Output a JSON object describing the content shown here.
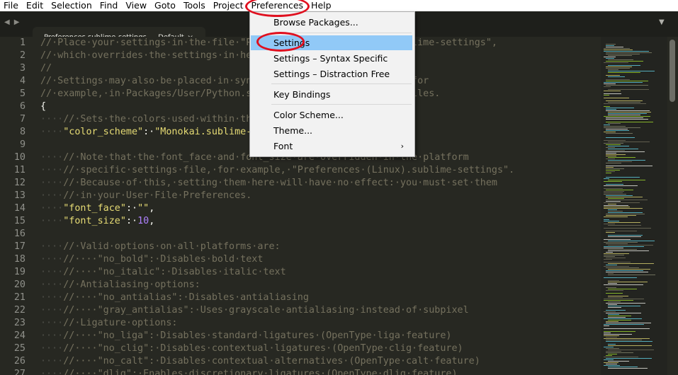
{
  "menubar": {
    "items": [
      "File",
      "Edit",
      "Selection",
      "Find",
      "View",
      "Goto",
      "Tools",
      "Project",
      "Preferences",
      "Help"
    ]
  },
  "tabbar": {
    "nav_arrows": "◀▶",
    "tab_title": "Preferences.sublime-settings — Default",
    "close_glyph": "×",
    "dropdown_glyph": "▼"
  },
  "dropdown": {
    "items": [
      "Browse Packages...",
      "Settings",
      "Settings – Syntax Specific",
      "Settings – Distraction Free",
      "Key Bindings",
      "Color Scheme...",
      "Theme...",
      "Font"
    ],
    "font_arrow": "›",
    "highlighted": "Settings"
  },
  "editor": {
    "lines": [
      {
        "n": "1",
        "segs": [
          [
            "cm",
            "//·Place·your·settings·in·the·file·\"Packages/User/Preferences.sublime-settings\","
          ]
        ]
      },
      {
        "n": "2",
        "segs": [
          [
            "cm",
            "//·which·overrides·the·settings·in·here."
          ]
        ]
      },
      {
        "n": "3",
        "segs": [
          [
            "cm",
            "//"
          ]
        ]
      },
      {
        "n": "4",
        "segs": [
          [
            "cm",
            "//·Settings·may·also·be·placed·in·syntax·specific·setting·files,·for"
          ]
        ]
      },
      {
        "n": "5",
        "segs": [
          [
            "cm",
            "//·example,·in·Packages/User/Python.sublime-settings·for·python·files."
          ]
        ]
      },
      {
        "n": "6",
        "segs": [
          [
            "punc",
            "{"
          ]
        ]
      },
      {
        "n": "7",
        "segs": [
          [
            "ws",
            "····"
          ],
          [
            "cm",
            "//·Sets·the·colors·used·within·the·text·area"
          ]
        ]
      },
      {
        "n": "8",
        "segs": [
          [
            "ws",
            "····"
          ],
          [
            "str",
            "\"color_scheme\""
          ],
          [
            "punc",
            ":·"
          ],
          [
            "str",
            "\"Monokai.sublime-color-scheme\""
          ],
          [
            "punc",
            ","
          ]
        ]
      },
      {
        "n": "9",
        "segs": []
      },
      {
        "n": "10",
        "segs": [
          [
            "ws",
            "····"
          ],
          [
            "cm",
            "//·Note·that·the·font_face·and·font_size·are·overridden·in·the·platform"
          ]
        ]
      },
      {
        "n": "11",
        "segs": [
          [
            "ws",
            "····"
          ],
          [
            "cm",
            "//·specific·settings·file,·for·example,·\"Preferences·(Linux).sublime-settings\"."
          ]
        ]
      },
      {
        "n": "12",
        "segs": [
          [
            "ws",
            "····"
          ],
          [
            "cm",
            "//·Because·of·this,·setting·them·here·will·have·no·effect:·you·must·set·them"
          ]
        ]
      },
      {
        "n": "13",
        "segs": [
          [
            "ws",
            "····"
          ],
          [
            "cm",
            "//·in·your·User·File·Preferences."
          ]
        ]
      },
      {
        "n": "14",
        "segs": [
          [
            "ws",
            "····"
          ],
          [
            "str",
            "\"font_face\""
          ],
          [
            "punc",
            ":·"
          ],
          [
            "str",
            "\"\""
          ],
          [
            "punc",
            ","
          ]
        ]
      },
      {
        "n": "15",
        "segs": [
          [
            "ws",
            "····"
          ],
          [
            "str",
            "\"font_size\""
          ],
          [
            "punc",
            ":·"
          ],
          [
            "num",
            "10"
          ],
          [
            "punc",
            ","
          ]
        ]
      },
      {
        "n": "16",
        "segs": []
      },
      {
        "n": "17",
        "segs": [
          [
            "ws",
            "····"
          ],
          [
            "cm",
            "//·Valid·options·on·all·platforms·are:"
          ]
        ]
      },
      {
        "n": "18",
        "segs": [
          [
            "ws",
            "····"
          ],
          [
            "cm",
            "//····\"no_bold\":·Disables·bold·text"
          ]
        ]
      },
      {
        "n": "19",
        "segs": [
          [
            "ws",
            "····"
          ],
          [
            "cm",
            "//····\"no_italic\":·Disables·italic·text"
          ]
        ]
      },
      {
        "n": "20",
        "segs": [
          [
            "ws",
            "····"
          ],
          [
            "cm",
            "//·Antialiasing·options:"
          ]
        ]
      },
      {
        "n": "21",
        "segs": [
          [
            "ws",
            "····"
          ],
          [
            "cm",
            "//····\"no_antialias\":·Disables·antialiasing"
          ]
        ]
      },
      {
        "n": "22",
        "segs": [
          [
            "ws",
            "····"
          ],
          [
            "cm",
            "//····\"gray_antialias\":·Uses·grayscale·antialiasing·instead·of·subpixel"
          ]
        ]
      },
      {
        "n": "23",
        "segs": [
          [
            "ws",
            "····"
          ],
          [
            "cm",
            "//·Ligature·options:"
          ]
        ]
      },
      {
        "n": "24",
        "segs": [
          [
            "ws",
            "····"
          ],
          [
            "cm",
            "//····\"no_liga\":·Disables·standard·ligatures·(OpenType·liga·feature)"
          ]
        ]
      },
      {
        "n": "25",
        "segs": [
          [
            "ws",
            "····"
          ],
          [
            "cm",
            "//····\"no_clig\":·Disables·contextual·ligatures·(OpenType·clig·feature)"
          ]
        ]
      },
      {
        "n": "26",
        "segs": [
          [
            "ws",
            "····"
          ],
          [
            "cm",
            "//····\"no_calt\":·Disables·contextual·alternatives·(OpenType·calt·feature)"
          ]
        ]
      },
      {
        "n": "27",
        "segs": [
          [
            "ws",
            "····"
          ],
          [
            "cm",
            "//····\"dlig\":·Enables·discretionary·ligatures·(OpenType·dlig·feature)"
          ]
        ]
      }
    ]
  },
  "colors": {
    "background": "#272822",
    "comment": "#75715e",
    "string": "#e6db74",
    "number": "#ae81ff",
    "menu_highlight": "#91c9f7",
    "annotation": "#e0101f"
  }
}
